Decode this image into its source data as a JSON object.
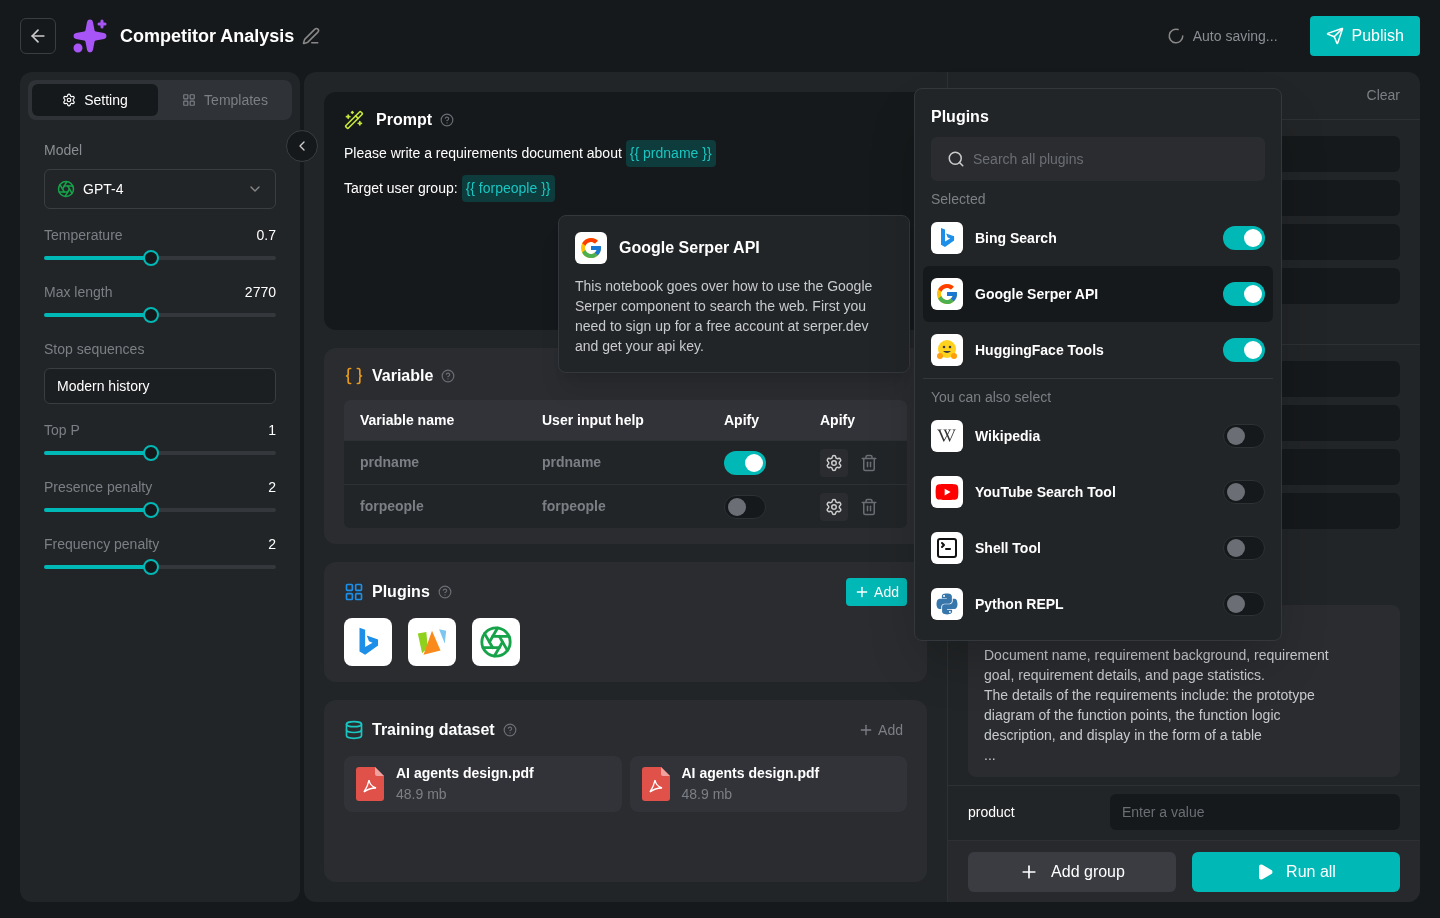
{
  "header": {
    "title": "Competitor Analysis",
    "autosave": "Auto saving...",
    "publish": "Publish"
  },
  "sidebar": {
    "tabs": [
      {
        "label": "Setting",
        "selected": true
      },
      {
        "label": "Templates",
        "selected": false
      }
    ],
    "model_label": "Model",
    "model": "GPT-4",
    "params": [
      {
        "kind": "slider",
        "label": "Temperature",
        "value": "0.7",
        "level": 0.46
      },
      {
        "kind": "slider",
        "label": "Max length",
        "value": "2770",
        "level": 0.46
      },
      {
        "kind": "field",
        "label": "Stop sequences",
        "value": "Modern history"
      },
      {
        "kind": "slider",
        "label": "Top P",
        "value": "1",
        "level": 0.46
      },
      {
        "kind": "slider",
        "label": "Presence penalty",
        "value": "2",
        "level": 0.46
      },
      {
        "kind": "slider",
        "label": "Frequency penalty",
        "value": "2",
        "level": 0.46
      }
    ]
  },
  "prompt": {
    "title": "Prompt",
    "lines": [
      {
        "text": "Please write a requirements document about",
        "variable": "{{ prdname }}"
      },
      {
        "text": "Target user group:",
        "variable": "{{ forpeople }}"
      }
    ]
  },
  "variable": {
    "title": "Variable",
    "columns": [
      "Variable name",
      "User input help",
      "Apify",
      "Apify"
    ],
    "rows": [
      {
        "name": "prdname",
        "help": "prdname",
        "on": true
      },
      {
        "name": "forpeople",
        "help": "forpeople",
        "on": false
      }
    ]
  },
  "plugins": {
    "title": "Plugins",
    "add": "Add",
    "installed": [
      {
        "kind": "bing"
      },
      {
        "kind": "apify"
      },
      {
        "kind": "openai"
      }
    ]
  },
  "training": {
    "title": "Training dataset",
    "add": "Add",
    "files": [
      {
        "name": "AI agents design.pdf",
        "size": "48.9 mb"
      },
      {
        "name": "AI agents design.pdf",
        "size": "48.9 mb"
      }
    ]
  },
  "output": {
    "clear": "Clear",
    "paragraphs": [
      "Document name, requirement background, requirement goal, requirement details, and page statistics.",
      "The details of the requirements include: the prototype diagram of the function points, the function logic description, and display in the form of a table",
      "..."
    ],
    "product_label": "product",
    "product_placeholder": "Enter a value",
    "add_group": "Add group",
    "run_all": "Run all"
  },
  "tooltip": {
    "title": "Google Serper API",
    "body": "This notebook goes over how to use the Google Serper component to search the web. First you need to sign up for a free account at serper.dev and get your api key."
  },
  "popover": {
    "title": "Plugins",
    "search_placeholder": "Search all plugins",
    "sections": [
      {
        "heading": "Selected",
        "items": [
          {
            "kind": "bing",
            "name": "Bing Search",
            "on": true,
            "selected": false
          },
          {
            "kind": "google",
            "name": "Google Serper API",
            "on": true,
            "selected": true
          },
          {
            "kind": "huggingface",
            "name": "HuggingFace Tools",
            "on": true,
            "selected": false
          }
        ]
      },
      {
        "heading": "You can also select",
        "items": [
          {
            "kind": "wikipedia",
            "name": "Wikipedia",
            "on": false,
            "selected": false
          },
          {
            "kind": "youtube",
            "name": "YouTube Search Tool",
            "on": false,
            "selected": false
          },
          {
            "kind": "shell",
            "name": "Shell Tool",
            "on": false,
            "selected": false
          },
          {
            "kind": "python",
            "name": "Python REPL",
            "on": false,
            "selected": false
          }
        ]
      }
    ]
  }
}
